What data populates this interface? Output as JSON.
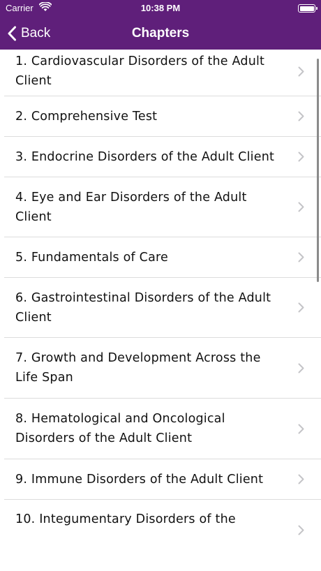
{
  "status_bar": {
    "carrier": "Carrier",
    "time": "10:38 PM",
    "wifi_icon": "wifi-icon",
    "battery_icon": "battery-icon"
  },
  "nav": {
    "back_label": "Back",
    "title": "Chapters",
    "bar_color": "#5f1f7a"
  },
  "chapters": [
    {
      "label": "1. Cardiovascular Disorders of the Adult Client"
    },
    {
      "label": "2. Comprehensive Test"
    },
    {
      "label": "3. Endocrine Disorders of the Adult Client"
    },
    {
      "label": "4. Eye and Ear Disorders of the Adult Client"
    },
    {
      "label": "5. Fundamentals of Care"
    },
    {
      "label": "6. Gastrointestinal Disorders of the Adult Client"
    },
    {
      "label": "7. Growth and Development Across the Life Span"
    },
    {
      "label": "8. Hematological and Oncological Disorders of the Adult Client"
    },
    {
      "label": "9. Immune Disorders of the Adult Client"
    },
    {
      "label": "10. Integumentary Disorders of the"
    }
  ]
}
